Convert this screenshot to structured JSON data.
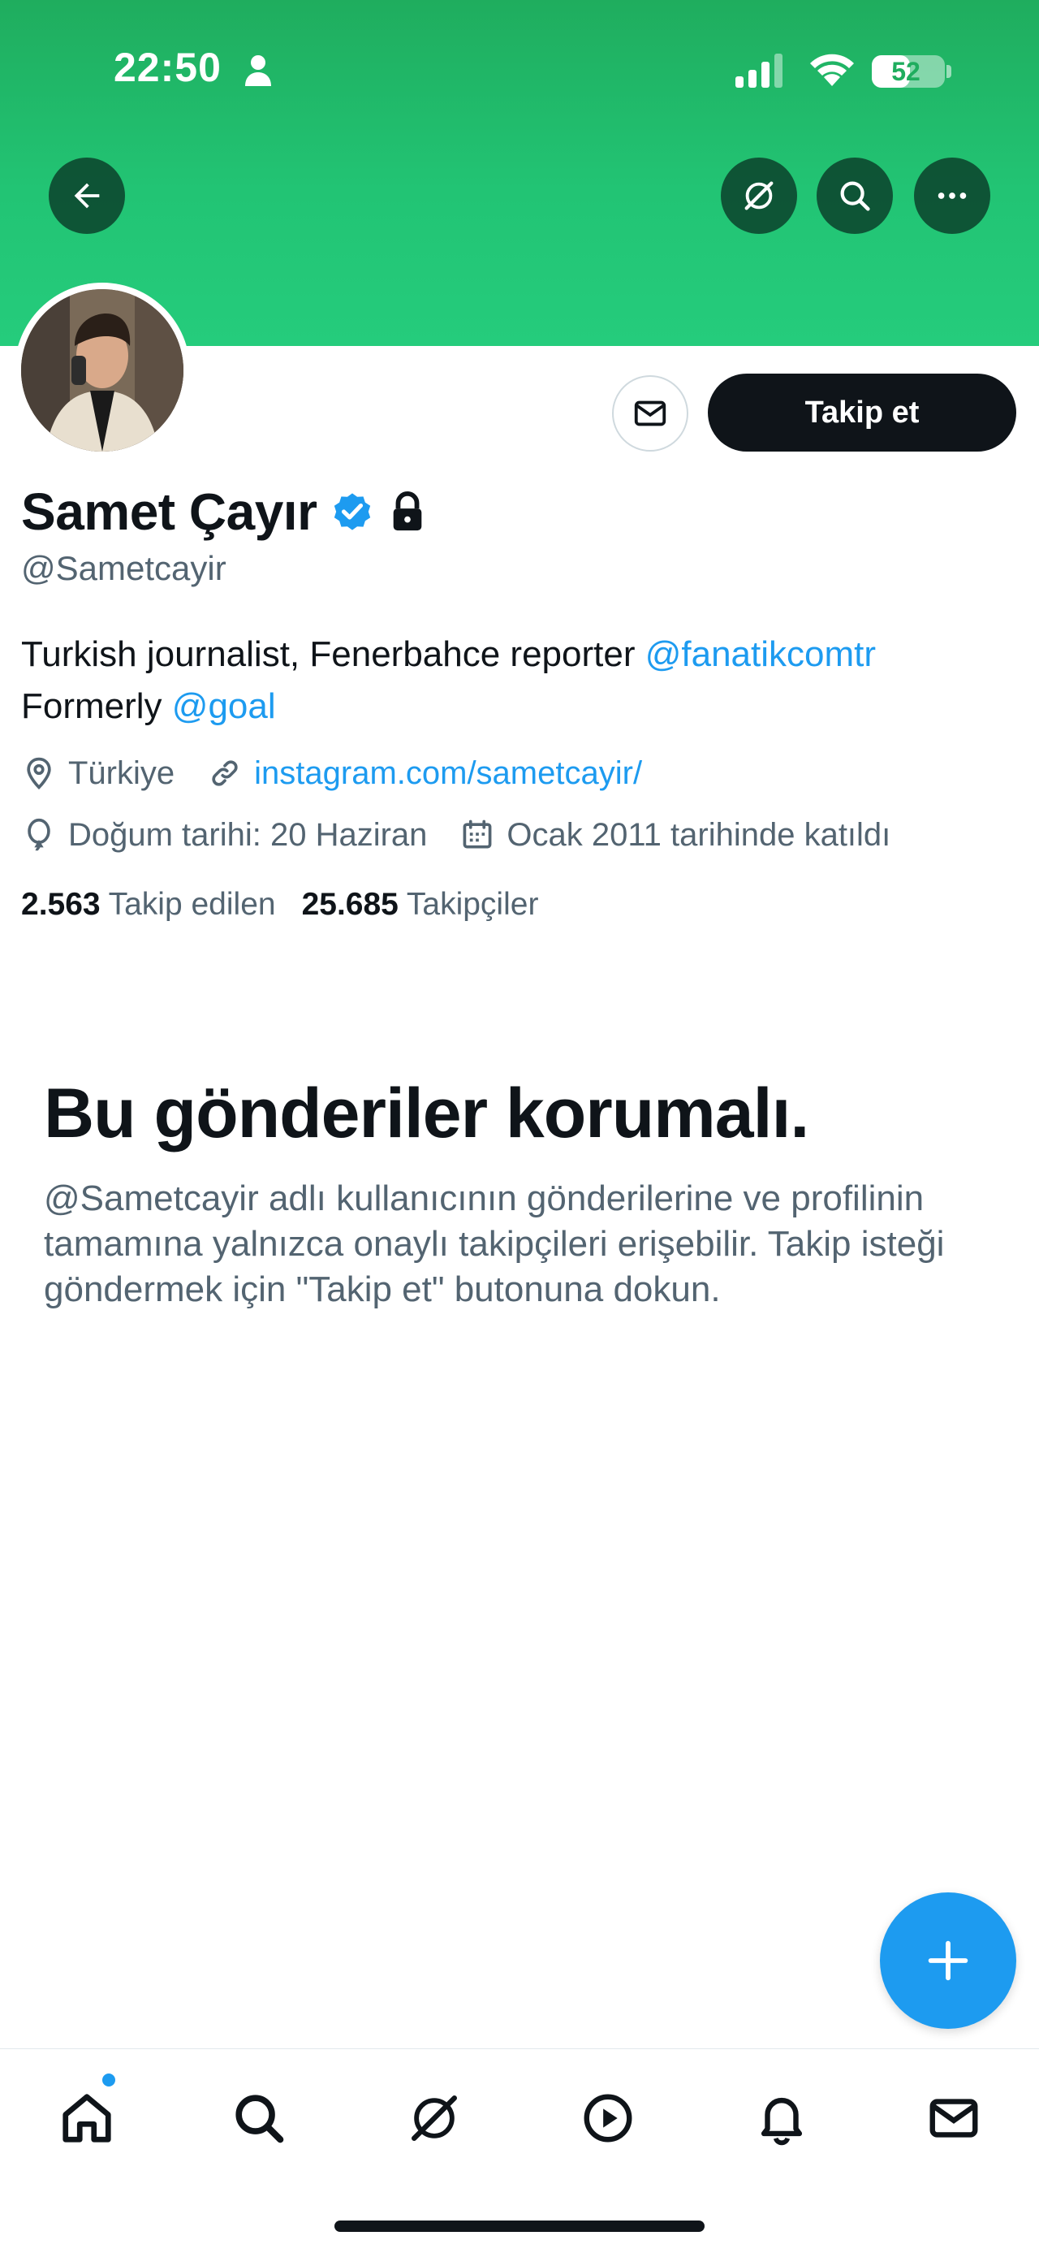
{
  "status_bar": {
    "time": "22:50",
    "battery": "52",
    "battery_level": 0.52
  },
  "header_actions": [
    {
      "icon": "arrow-left-icon"
    },
    {
      "icon": "grok-icon"
    },
    {
      "icon": "search-icon"
    },
    {
      "icon": "more-icon"
    }
  ],
  "profile": {
    "name": "Samet Çayır",
    "handle": "@Sametcayir",
    "follow_label": "Takip et",
    "bio_line1": "Turkish journalist, Fenerbahce reporter ",
    "bio_mention1": "@fanatikcomtr",
    "bio_line2": "Formerly ",
    "bio_mention2": "@goal",
    "location": "Türkiye",
    "website": "instagram.com/sametcayir/",
    "birthday": "Doğum tarihi: 20 Haziran",
    "joined": "Ocak 2011 tarihinde katıldı",
    "following_count": "2.563",
    "following_label": "Takip edilen",
    "followers_count": "25.685",
    "followers_label": "Takipçiler"
  },
  "protected": {
    "title": "Bu gönderiler korumalı.",
    "text": "@Sametcayir adlı kullanıcının gönderilerine ve profilinin tamamına yalnızca onaylı takipçileri erişebilir. Takip isteği göndermek için \"Takip et\" butonuna dokun."
  },
  "tabs": [
    {
      "icon": "home-icon"
    },
    {
      "icon": "search-icon"
    },
    {
      "icon": "grok-icon"
    },
    {
      "icon": "play-icon"
    },
    {
      "icon": "bell-icon"
    },
    {
      "icon": "mail-icon"
    }
  ],
  "colors": {
    "banner": "#22c474",
    "accent": "#1d9bf0",
    "text": "#0f1419",
    "secondary": "#536471"
  }
}
